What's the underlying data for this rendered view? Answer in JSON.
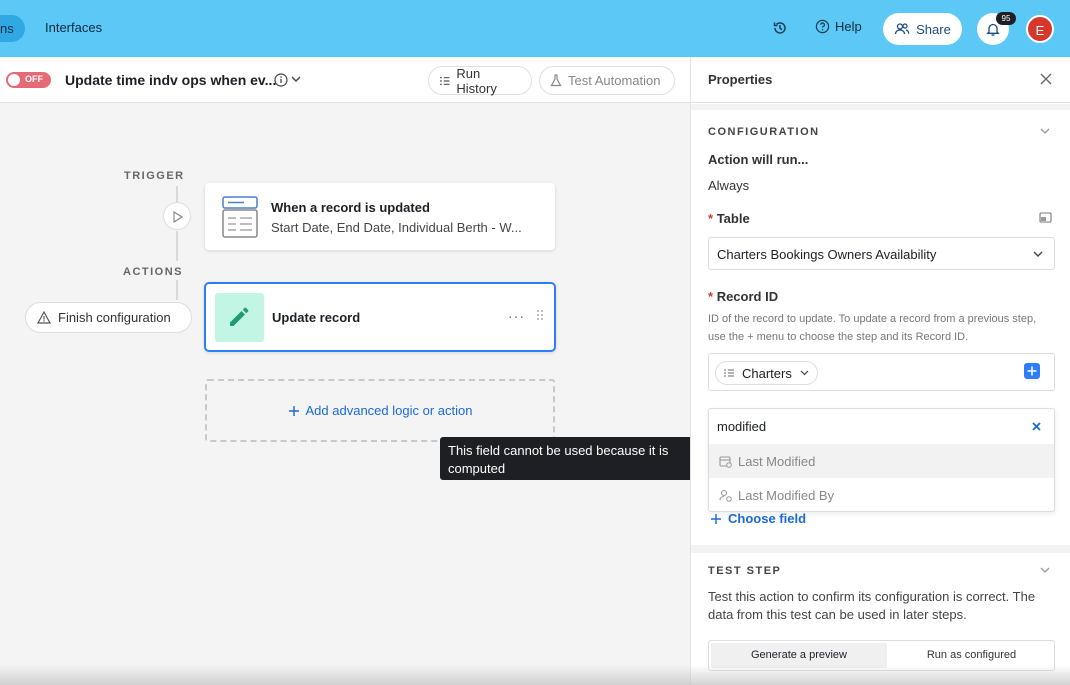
{
  "topbar": {
    "tab_partial": "ns",
    "tab_interfaces": "Interfaces",
    "help_label": "Help",
    "share_label": "Share",
    "notification_count": "95",
    "avatar_initial": "E"
  },
  "toolbar": {
    "toggle_label": "OFF",
    "automation_title": "Update time indv ops when ev...",
    "run_history_label": "Run History",
    "test_automation_label": "Test Automation"
  },
  "canvas": {
    "trigger_heading": "TRIGGER",
    "actions_heading": "ACTIONS",
    "trigger_title": "When a record is updated",
    "trigger_subtitle": "Start Date, End Date, Individual Berth - W...",
    "action_title": "Update record",
    "action_more": "···",
    "finish_config_label": "Finish configuration",
    "add_logic_label": "Add advanced logic or action",
    "tooltip_text": "This field cannot be used because it is computed"
  },
  "panel": {
    "title": "Properties",
    "configuration_heading": "CONFIGURATION",
    "action_will_run_label": "Action will run...",
    "action_will_run_value": "Always",
    "table_label": "Table",
    "required_mark": "*",
    "table_value": "Charters Bookings Owners Availability",
    "record_id_label": "Record ID",
    "record_id_help": "ID of the record to update. To update a record from a previous step, use the + menu to choose the step and its Record ID.",
    "record_chip_label": "Charters",
    "field_search_value": "modified",
    "field_options": [
      "Last Modified",
      "Last Modified By"
    ],
    "choose_field_label": "Choose field",
    "test_step_heading": "TEST STEP",
    "test_step_desc": "Test this action to confirm its configuration is correct. The data from this test can be used in later steps.",
    "generate_preview_label": "Generate a preview",
    "run_as_configured_label": "Run as configured"
  },
  "colors": {
    "topbar": "#5cc8f5",
    "accent_blue": "#2d7ff9",
    "toggle_off": "#e66a76",
    "avatar": "#d6392b",
    "action_icon_bg": "#c2f5e3"
  }
}
